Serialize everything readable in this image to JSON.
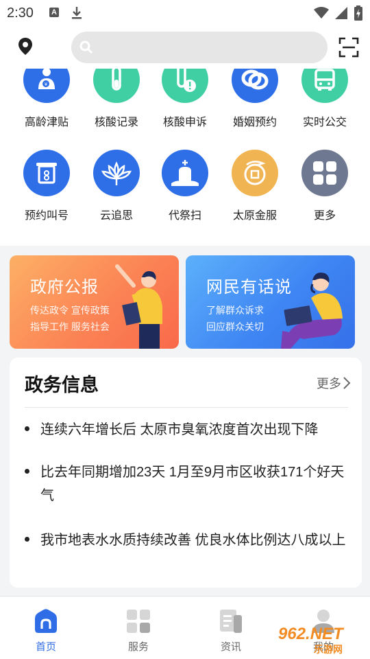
{
  "status_bar": {
    "time": "2:30",
    "notif_letter": "A"
  },
  "search": {
    "placeholder": ""
  },
  "services": [
    {
      "label": "高龄津贴",
      "icon": "elderly-allowance-icon",
      "color": "#2e6fe8"
    },
    {
      "label": "核酸记录",
      "icon": "test-tube-icon",
      "color": "#3fcfa3"
    },
    {
      "label": "核酸申诉",
      "icon": "test-tube-alert-icon",
      "color": "#3fcfa3"
    },
    {
      "label": "婚姻预约",
      "icon": "marriage-rings-icon",
      "color": "#2e6fe8"
    },
    {
      "label": "实时公交",
      "icon": "bus-icon",
      "color": "#3fcfa3"
    },
    {
      "label": "预约叫号",
      "icon": "queue-ticket-icon",
      "color": "#2e6fe8"
    },
    {
      "label": "云追思",
      "icon": "chrysanthemum-icon",
      "color": "#2e6fe8"
    },
    {
      "label": "代祭扫",
      "icon": "memorial-icon",
      "color": "#2e6fe8"
    },
    {
      "label": "太原金服",
      "icon": "finance-dragon-icon",
      "color": "#f0b552"
    },
    {
      "label": "更多",
      "icon": "more-grid-icon",
      "color": "#6e7890"
    }
  ],
  "banners": [
    {
      "title": "政府公报",
      "line1": "传达政令  宣传政策",
      "line2": "指导工作  服务社会"
    },
    {
      "title": "网民有话说",
      "line1": "了解群众诉求",
      "line2": "回应群众关切"
    }
  ],
  "news": {
    "title": "政务信息",
    "more": "更多",
    "items": [
      "连续六年增长后 太原市臭氧浓度首次出现下降",
      "比去年同期增加23天 1月至9月市区收获171个好天气",
      "我市地表水水质持续改善 优良水体比例达八成以上"
    ]
  },
  "bottom_nav": [
    {
      "label": "首页",
      "icon": "home-icon",
      "active": true
    },
    {
      "label": "服务",
      "icon": "services-grid-icon",
      "active": false
    },
    {
      "label": "资讯",
      "icon": "news-doc-icon",
      "active": false
    },
    {
      "label": "我的",
      "icon": "profile-icon",
      "active": false
    }
  ],
  "watermark": {
    "brand": "962.NET",
    "sub": "乐游网"
  },
  "colors": {
    "accent": "#2f6de6",
    "teal": "#3fcfa3",
    "orange": "#fb8455",
    "blue_banner": "#3f86f3"
  }
}
